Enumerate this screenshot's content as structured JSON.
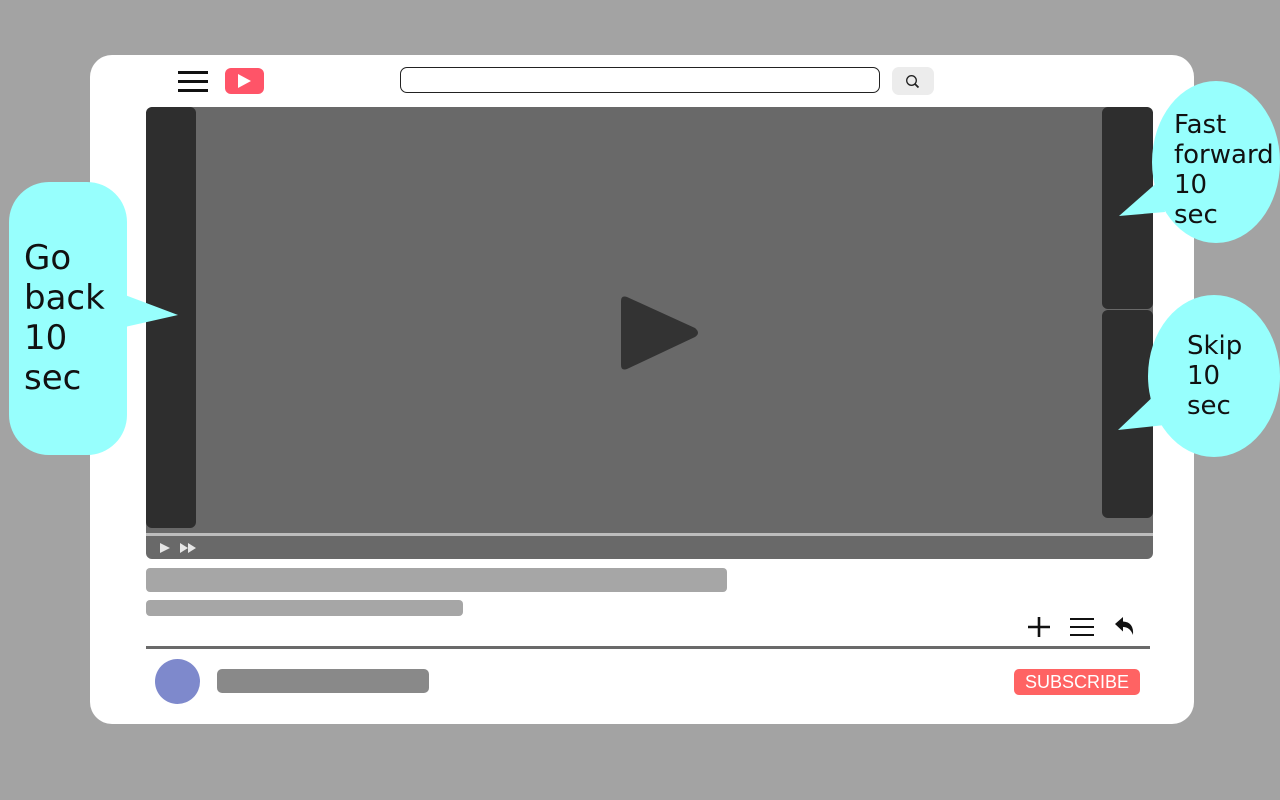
{
  "header": {
    "menu_icon": "hamburger-menu-icon",
    "logo_icon": "video-play-logo-icon",
    "search": {
      "value": "",
      "placeholder": ""
    },
    "search_button_icon": "search-icon"
  },
  "colors": {
    "background": "#a3a3a3",
    "window": "#ffffff",
    "logo": "#ff5468",
    "player": "#696969",
    "tap_zone": "#2e2e2e",
    "bubble": "#97fffd",
    "avatar": "#7e89cc",
    "subscribe": "#ff6363"
  },
  "player": {
    "big_play_icon": "play-icon",
    "controls": [
      {
        "name": "play",
        "icon": "play-icon"
      },
      {
        "name": "fast-forward",
        "icon": "fast-forward-icon"
      }
    ],
    "zones": [
      {
        "name": "go-back",
        "label": "Go back 10 sec"
      },
      {
        "name": "fast-forward",
        "label": "Fast forward 10 sec"
      },
      {
        "name": "skip",
        "label": "Skip 10 sec"
      }
    ]
  },
  "annotations": {
    "back": "Go\nback\n10\nsec",
    "fast_forward": "Fast\nforward\n10\nsec",
    "skip": "Skip\n10\nsec"
  },
  "actions": [
    {
      "name": "add",
      "icon": "plus-icon"
    },
    {
      "name": "playlist",
      "icon": "list-icon"
    },
    {
      "name": "share",
      "icon": "share-arrow-icon"
    }
  ],
  "channel": {
    "subscribe_label": "SUBSCRIBE"
  }
}
